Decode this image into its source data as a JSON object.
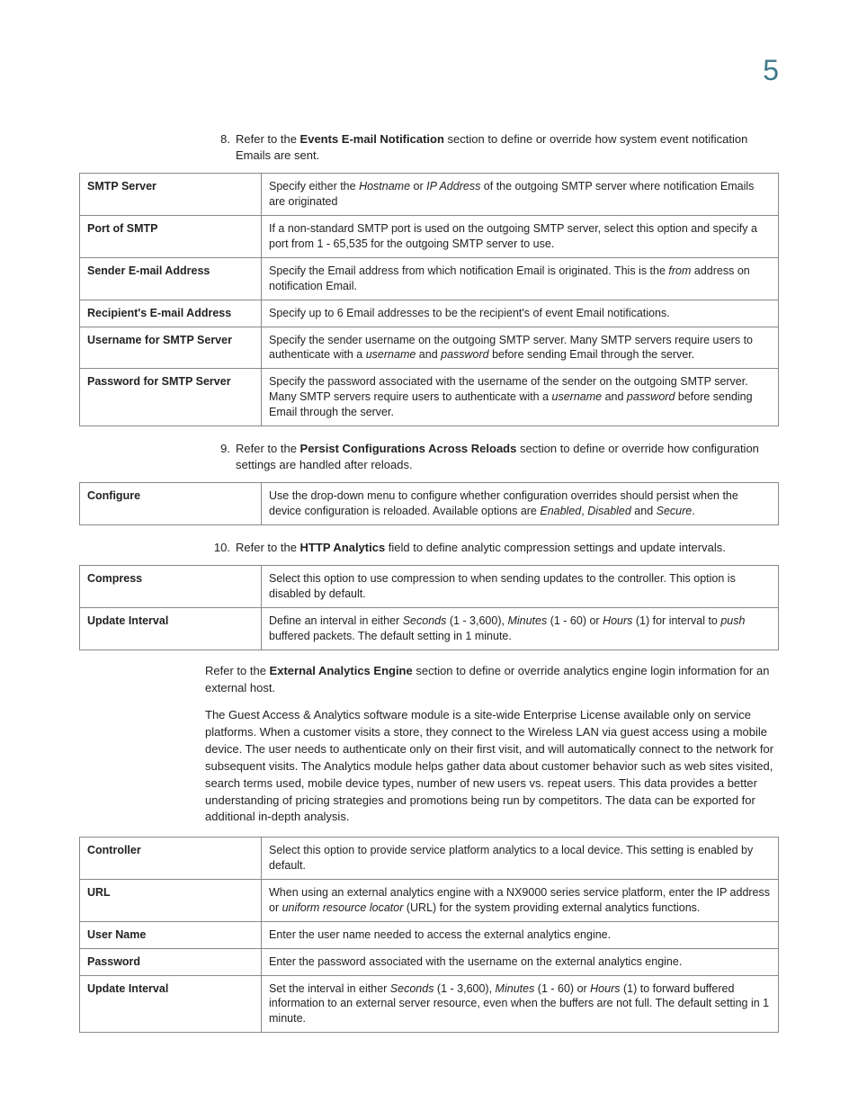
{
  "chapter_number": "5",
  "step8": {
    "num": "8.",
    "prefix": "Refer to the ",
    "bold": "Events E-mail Notification",
    "suffix": " section to define or override how system event notification Emails are sent."
  },
  "table_events": {
    "rows": [
      {
        "label": "SMTP Server",
        "t1": "Specify either the ",
        "i1": "Hostname",
        "t2": " or ",
        "i2": "IP Address",
        "t3": " of the outgoing SMTP server where notification Emails are originated"
      },
      {
        "label": "Port of SMTP",
        "t1": "If a non-standard SMTP port is used on the outgoing SMTP server, select this option and specify a port from 1 - 65,535 for the outgoing SMTP server to use."
      },
      {
        "label": "Sender E-mail Address",
        "t1": "Specify the Email address from which notification Email is originated. This is the ",
        "i1": "from",
        "t2": " address on notification Email."
      },
      {
        "label": "Recipient's E-mail Address",
        "t1": "Specify up to 6 Email addresses to be the recipient's of event Email notifications."
      },
      {
        "label": "Username for SMTP Server",
        "t1": "Specify the sender username on the outgoing SMTP server. Many SMTP servers require users to authenticate with a ",
        "i1": "username",
        "t2": " and ",
        "i2": "password",
        "t3": " before sending Email through the server."
      },
      {
        "label": "Password for SMTP Server",
        "t1": "Specify the password associated with the username of the sender on the outgoing SMTP server. Many SMTP servers require users to authenticate with a ",
        "i1": "username",
        "t2": " and ",
        "i2": "password",
        "t3": " before sending Email through the server."
      }
    ]
  },
  "step9": {
    "num": "9.",
    "prefix": "Refer to the ",
    "bold": "Persist Configurations Across Reloads",
    "suffix": " section to define or override how configuration settings are handled after reloads."
  },
  "table_persist": {
    "rows": [
      {
        "label": "Configure",
        "t1": "Use the drop-down menu to configure whether configuration overrides should persist when the device configuration is reloaded. Available options are ",
        "i1": "Enabled",
        "t2": ", ",
        "i2": "Disabled",
        "t3": " and ",
        "i3": "Secure",
        "t4": "."
      }
    ]
  },
  "step10": {
    "num": "10.",
    "prefix": "Refer to the ",
    "bold": "HTTP Analytics",
    "suffix": " field to define analytic compression settings and update intervals."
  },
  "table_http": {
    "rows": [
      {
        "label": "Compress",
        "t1": "Select this option to use compression to when sending updates to the controller. This option is disabled by default."
      },
      {
        "label": "Update Interval",
        "t1": "Define an interval in either ",
        "i1": "Seconds",
        "t2": " (1 - 3,600), ",
        "i2": "Minutes",
        "t3": " (1 - 60) or ",
        "i3": "Hours",
        "t4": " (1) for interval to ",
        "i4": "push",
        "t5": " buffered packets. The default setting in 1 minute."
      }
    ]
  },
  "para_ext": {
    "prefix": "Refer to the ",
    "bold": "External Analytics Engine",
    "suffix": " section to define or override analytics engine login information for an external host."
  },
  "para_guest": "The Guest Access & Analytics software module is a site-wide Enterprise License available only on service platforms. When a customer visits a store, they connect to the Wireless LAN via guest access using a mobile device. The user needs to authenticate only on their first visit, and will automatically connect to the network for subsequent visits. The Analytics module helps gather data about customer behavior such as web sites visited, search terms used, mobile device types, number of new users vs. repeat users. This data provides a better understanding of pricing strategies and promotions being run by competitors. The data can be exported for additional in-depth analysis.",
  "table_ext": {
    "rows": [
      {
        "label": "Controller",
        "t1": "Select this option to provide service platform analytics to a local device. This setting is enabled by default."
      },
      {
        "label": "URL",
        "t1": "When using an external analytics engine with a NX9000 series service platform, enter the IP address or ",
        "i1": "uniform resource locator",
        "t2": " (URL) for the system providing external analytics functions."
      },
      {
        "label": "User Name",
        "t1": "Enter the user name needed to access the external analytics engine."
      },
      {
        "label": "Password",
        "t1": "Enter the password associated with the username on the external analytics engine."
      },
      {
        "label": "Update Interval",
        "t1": "Set the interval in either ",
        "i1": "Seconds",
        "t2": " (1 - 3,600), ",
        "i2": "Minutes",
        "t3": " (1 - 60) or ",
        "i3": "Hours",
        "t4": " (1) to forward buffered information to an external server resource, even when the buffers are not full. The default setting in 1 minute."
      }
    ]
  }
}
